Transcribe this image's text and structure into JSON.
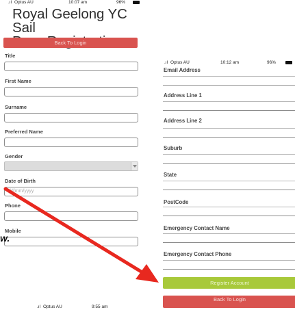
{
  "left_screen": {
    "status": {
      "carrier": "Optus AU",
      "time": "10:07 am",
      "battery": "96%"
    },
    "title_line1": "Royal Geelong YC Sail",
    "title_line2": "Pass Registration",
    "back_to_login": "Back To Login",
    "fields": {
      "title": "Title",
      "first_name": "First Name",
      "surname": "Surname",
      "preferred_name": "Preferred Name",
      "gender": "Gender",
      "date_of_birth": "Date of Birth",
      "date_placeholder": "dd/mm/yyyy",
      "phone": "Phone",
      "mobile": "Mobile"
    }
  },
  "right_screen": {
    "status": {
      "carrier": "Optus AU",
      "time": "10:12 am",
      "battery": "96%"
    },
    "fields": {
      "email": "Email Address",
      "address1": "Address Line 1",
      "address2": "Address Line 2",
      "suburb": "Suburb",
      "state": "State",
      "postcode": "PostCode",
      "emergency_name": "Emergency Contact Name",
      "emergency_phone": "Emergency Contact Phone"
    },
    "register_button": "Register Account",
    "back_to_login": "Back To Login",
    "status_bottom": {
      "carrier": "Optus AU",
      "time": "9:55 am"
    }
  },
  "overlay_mark": "w.",
  "colors": {
    "red": "#d9534f",
    "green": "#a8c93a",
    "arrow": "#e8281f"
  }
}
